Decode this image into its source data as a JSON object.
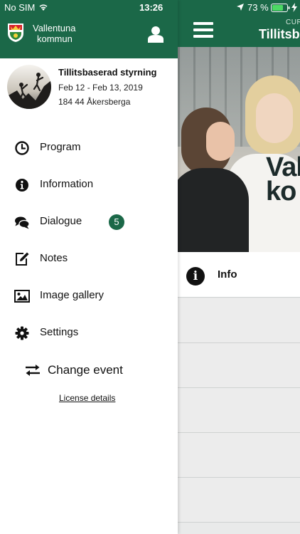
{
  "status_bar": {
    "carrier": "No SIM",
    "time": "13:26",
    "battery": "73 %"
  },
  "drawer": {
    "logo_line1": "Vallentuna",
    "logo_line2": "kommun",
    "event": {
      "title": "Tillitsbaserad styrning",
      "dates": "Feb 12 - Feb 13, 2019",
      "location": "184 44 Åkersberga"
    },
    "menu": [
      {
        "label": "Program",
        "icon": "clock-icon"
      },
      {
        "label": "Information",
        "icon": "info-icon"
      },
      {
        "label": "Dialogue",
        "icon": "chat-icon",
        "badge": "5"
      },
      {
        "label": "Notes",
        "icon": "edit-icon"
      },
      {
        "label": "Image gallery",
        "icon": "image-icon"
      },
      {
        "label": "Settings",
        "icon": "gear-icon"
      }
    ],
    "change_event": "Change event",
    "license": "License details"
  },
  "main": {
    "header_sub": "CUR",
    "header_title": "Tillitsb",
    "hero_line1": "Val",
    "hero_line2": "ko",
    "info_label": "Info"
  },
  "colors": {
    "brand_green": "#1b6848"
  }
}
